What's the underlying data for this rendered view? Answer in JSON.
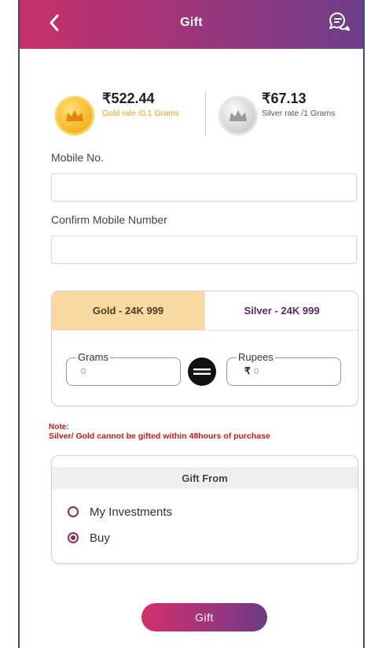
{
  "header": {
    "title": "Gift",
    "back_icon": "chevron-left-icon",
    "chat_icon": "chat-bubbles-icon"
  },
  "rates": {
    "gold": {
      "price": "₹522.44",
      "label": "Gold rate /0.1 Grams"
    },
    "silver": {
      "price": "₹67.13",
      "label": "Silver rate /1 Grams"
    }
  },
  "form": {
    "mobile_label": "Mobile No.",
    "mobile_value": "",
    "confirm_label": "Confirm Mobile Number",
    "confirm_value": ""
  },
  "metal": {
    "tabs": [
      {
        "label": "Gold - 24K 999",
        "active": true
      },
      {
        "label": "Silver - 24K 999",
        "active": false
      }
    ],
    "grams_label": "Grams",
    "grams_value": "0",
    "rupees_label": "Rupees",
    "rupee_symbol": "₹",
    "rupees_value": "0"
  },
  "note": {
    "title": "Note:",
    "text": "Silver/ Gold cannot be gifted within 48hours of purchase"
  },
  "gift_from": {
    "title": "Gift From",
    "options": [
      {
        "label": "My Investments",
        "checked": false
      },
      {
        "label": "Buy",
        "checked": true
      }
    ]
  },
  "actions": {
    "gift_label": "Gift"
  },
  "colors": {
    "header_start": "#c8306a",
    "header_end": "#6e3e8a",
    "gold_tab": "#f9d9a2",
    "note": "#c41a1a",
    "radio": "#8a2a5e"
  }
}
